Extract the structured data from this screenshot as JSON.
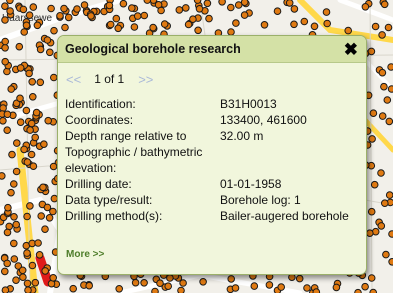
{
  "map": {
    "place_label": "Haarssewe",
    "colors": {
      "background": "#f2f0ea",
      "marker_fill": "#e07a12",
      "marker_stroke": "#1a1a1a",
      "road_yellow": "#ffd84a",
      "road_white": "#ffffff",
      "road_red": "#e01b1b"
    }
  },
  "popup": {
    "title": "Geological borehole research",
    "close_icon": "close-icon",
    "pager": {
      "prev_label": "<<",
      "current": "1 of 1",
      "next_label": ">>"
    },
    "rows": [
      {
        "label": "Identification:",
        "value": "B31H0013"
      },
      {
        "label": "Coordinates:",
        "value": "133400, 461600"
      },
      {
        "label": "Depth range relative to Topographic / bathymetric elevation:",
        "value": "32.00 m"
      },
      {
        "label": "Drilling date:",
        "value": "01-01-1958"
      },
      {
        "label": "Data type/result:",
        "value": "Borehole log: 1"
      },
      {
        "label": "Drilling method(s):",
        "value": "Bailer-augered borehole"
      }
    ],
    "more_label": "More >>"
  }
}
